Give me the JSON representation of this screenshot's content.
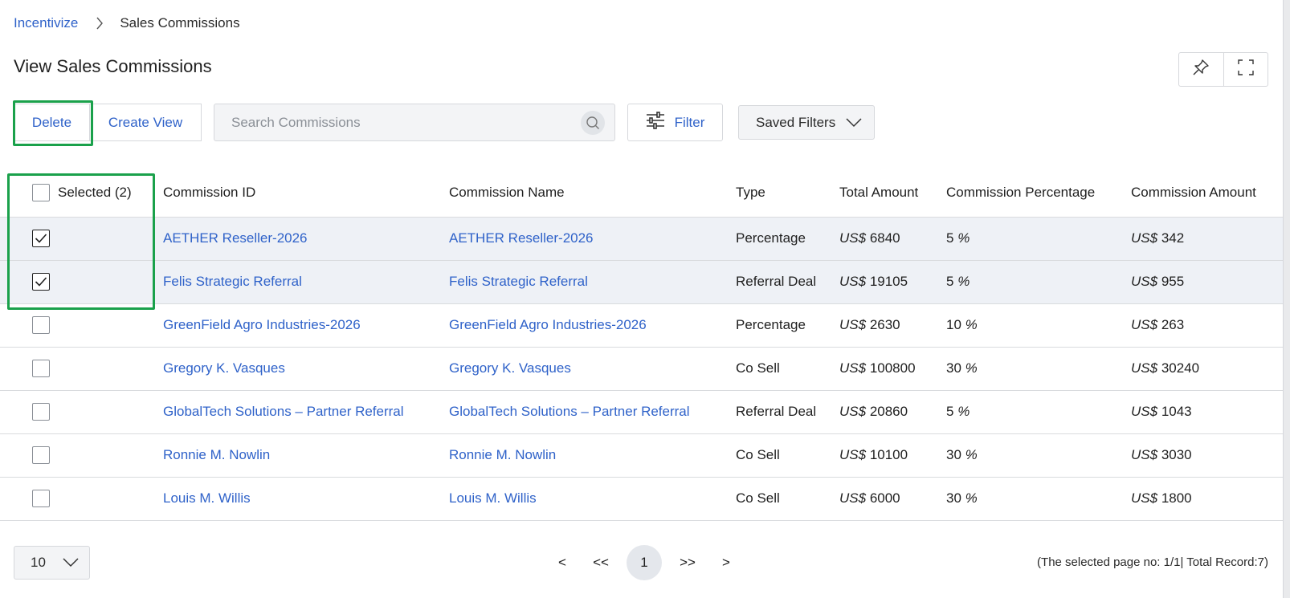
{
  "breadcrumb": {
    "parent": "Incentivize",
    "current": "Sales Commissions"
  },
  "page_title": "View Sales Commissions",
  "toolbar": {
    "delete_label": "Delete",
    "create_view_label": "Create View",
    "search_placeholder": "Search Commissions",
    "filter_label": "Filter",
    "saved_filters_label": "Saved Filters"
  },
  "table": {
    "selected_header": "Selected (2)",
    "columns": [
      "Commission ID",
      "Commission Name",
      "Type",
      "Total Amount",
      "Commission Percentage",
      "Commission Amount"
    ],
    "rows": [
      {
        "checked": true,
        "id": "AETHER Reseller-2026",
        "name": "AETHER Reseller-2026",
        "type": "Percentage",
        "cur": "US$",
        "total": "6840",
        "pct": "5",
        "pct_sign": "%",
        "amount": "342"
      },
      {
        "checked": true,
        "id": "Felis Strategic Referral",
        "name": "Felis Strategic Referral",
        "type": "Referral Deal",
        "cur": "US$",
        "total": "19105",
        "pct": "5",
        "pct_sign": "%",
        "amount": "955"
      },
      {
        "checked": false,
        "id": "GreenField Agro Industries-2026",
        "name": "GreenField Agro Industries-2026",
        "type": "Percentage",
        "cur": "US$",
        "total": "2630",
        "pct": "10",
        "pct_sign": "%",
        "amount": "263"
      },
      {
        "checked": false,
        "id": "Gregory K. Vasques",
        "name": "Gregory K. Vasques",
        "type": "Co Sell",
        "cur": "US$",
        "total": "100800",
        "pct": "30",
        "pct_sign": "%",
        "amount": "30240"
      },
      {
        "checked": false,
        "id": "GlobalTech Solutions – Partner Referral",
        "name": "GlobalTech Solutions – Partner Referral",
        "type": "Referral Deal",
        "cur": "US$",
        "total": "20860",
        "pct": "5",
        "pct_sign": "%",
        "amount": "1043"
      },
      {
        "checked": false,
        "id": "Ronnie M. Nowlin",
        "name": "Ronnie M. Nowlin",
        "type": "Co Sell",
        "cur": "US$",
        "total": "10100",
        "pct": "30",
        "pct_sign": "%",
        "amount": "3030"
      },
      {
        "checked": false,
        "id": "Louis M. Willis",
        "name": "Louis M. Willis",
        "type": "Co Sell",
        "cur": "US$",
        "total": "6000",
        "pct": "30",
        "pct_sign": "%",
        "amount": "1800"
      }
    ]
  },
  "pagination": {
    "page_size": "10",
    "prev": "<",
    "first": "<<",
    "current_page": "1",
    "last": ">>",
    "next": ">",
    "info": "(The selected page no: 1/1| Total Record:7)"
  },
  "colors": {
    "link": "#2f62c9",
    "highlight": "#1aa14b",
    "selected_row_bg": "#eef1f6"
  },
  "icons": [
    "chevron-right-icon",
    "pin-icon",
    "fullscreen-icon",
    "search-icon",
    "filter-sliders-icon",
    "chevron-down-icon",
    "checkmark-icon"
  ]
}
